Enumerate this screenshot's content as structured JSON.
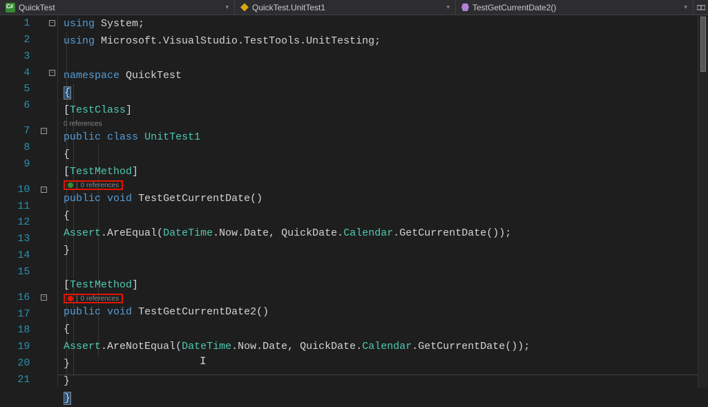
{
  "nav": {
    "project": "QuickTest",
    "class": "QuickTest.UnitTest1",
    "member": "TestGetCurrentDate2()"
  },
  "codelens": {
    "class": "0 references",
    "method1": "0 references",
    "method2": "0 references"
  },
  "code": {
    "l1_using": "using",
    "l1_system": "System",
    "l2_using": "using",
    "l2_ns": "Microsoft.VisualStudio.TestTools.UnitTesting",
    "l4_namespace": "namespace",
    "l4_name": "QuickTest",
    "l5_brace": "{",
    "l6_attr_open": "[",
    "l6_attr": "TestClass",
    "l6_attr_close": "]",
    "l7_public": "public",
    "l7_class": "class",
    "l7_name": "UnitTest1",
    "l8_brace": "{",
    "l9_attr_open": "[",
    "l9_attr": "TestMethod",
    "l9_attr_close": "]",
    "l10_public": "public",
    "l10_void": "void",
    "l10_name": "TestGetCurrentDate",
    "l10_parens": "()",
    "l11_brace": "{",
    "l12_assert": "Assert",
    "l12_method": "AreEqual",
    "l12_dt": "DateTime",
    "l12_now": "Now",
    "l12_date": "Date",
    "l12_qd": "QuickDate",
    "l12_cal": "Calendar",
    "l12_get": "GetCurrentDate",
    "l13_brace": "}",
    "l15_attr_open": "[",
    "l15_attr": "TestMethod",
    "l15_attr_close": "]",
    "l16_public": "public",
    "l16_void": "void",
    "l16_name": "TestGetCurrentDate2",
    "l16_parens": "()",
    "l17_brace": "{",
    "l18_assert": "Assert",
    "l18_method": "AreNotEqual",
    "l18_dt": "DateTime",
    "l18_now": "Now",
    "l18_date": "Date",
    "l18_qd": "QuickDate",
    "l18_cal": "Calendar",
    "l18_get": "GetCurrentDate",
    "l19_brace": "}",
    "l20_brace": "}",
    "l21_brace": "}"
  },
  "lines": [
    "1",
    "2",
    "3",
    "4",
    "5",
    "6",
    "7",
    "8",
    "9",
    "10",
    "11",
    "12",
    "13",
    "14",
    "15",
    "16",
    "17",
    "18",
    "19",
    "20",
    "21"
  ]
}
